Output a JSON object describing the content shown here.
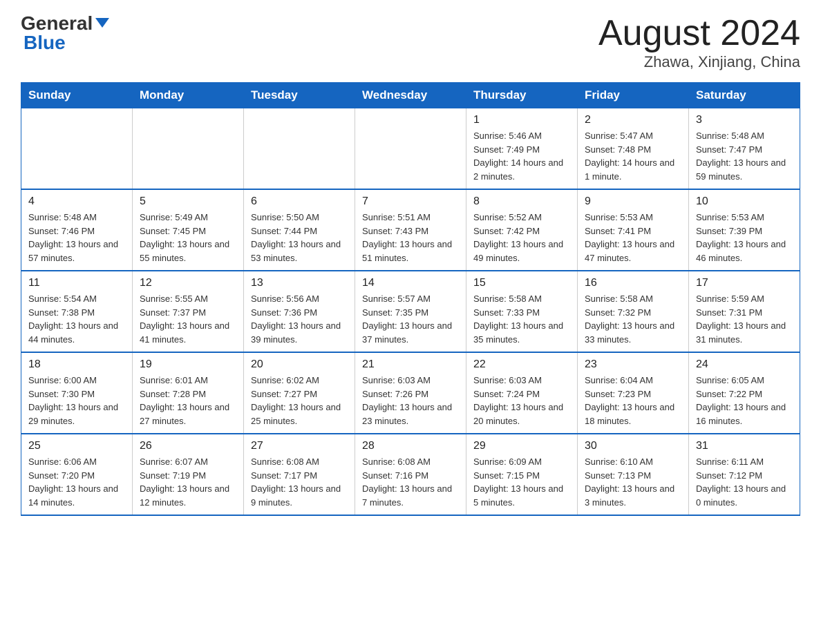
{
  "logo": {
    "general": "General",
    "blue": "Blue"
  },
  "header": {
    "month": "August 2024",
    "location": "Zhawa, Xinjiang, China"
  },
  "days_of_week": [
    "Sunday",
    "Monday",
    "Tuesday",
    "Wednesday",
    "Thursday",
    "Friday",
    "Saturday"
  ],
  "weeks": [
    [
      {
        "day": "",
        "info": ""
      },
      {
        "day": "",
        "info": ""
      },
      {
        "day": "",
        "info": ""
      },
      {
        "day": "",
        "info": ""
      },
      {
        "day": "1",
        "info": "Sunrise: 5:46 AM\nSunset: 7:49 PM\nDaylight: 14 hours and 2 minutes."
      },
      {
        "day": "2",
        "info": "Sunrise: 5:47 AM\nSunset: 7:48 PM\nDaylight: 14 hours and 1 minute."
      },
      {
        "day": "3",
        "info": "Sunrise: 5:48 AM\nSunset: 7:47 PM\nDaylight: 13 hours and 59 minutes."
      }
    ],
    [
      {
        "day": "4",
        "info": "Sunrise: 5:48 AM\nSunset: 7:46 PM\nDaylight: 13 hours and 57 minutes."
      },
      {
        "day": "5",
        "info": "Sunrise: 5:49 AM\nSunset: 7:45 PM\nDaylight: 13 hours and 55 minutes."
      },
      {
        "day": "6",
        "info": "Sunrise: 5:50 AM\nSunset: 7:44 PM\nDaylight: 13 hours and 53 minutes."
      },
      {
        "day": "7",
        "info": "Sunrise: 5:51 AM\nSunset: 7:43 PM\nDaylight: 13 hours and 51 minutes."
      },
      {
        "day": "8",
        "info": "Sunrise: 5:52 AM\nSunset: 7:42 PM\nDaylight: 13 hours and 49 minutes."
      },
      {
        "day": "9",
        "info": "Sunrise: 5:53 AM\nSunset: 7:41 PM\nDaylight: 13 hours and 47 minutes."
      },
      {
        "day": "10",
        "info": "Sunrise: 5:53 AM\nSunset: 7:39 PM\nDaylight: 13 hours and 46 minutes."
      }
    ],
    [
      {
        "day": "11",
        "info": "Sunrise: 5:54 AM\nSunset: 7:38 PM\nDaylight: 13 hours and 44 minutes."
      },
      {
        "day": "12",
        "info": "Sunrise: 5:55 AM\nSunset: 7:37 PM\nDaylight: 13 hours and 41 minutes."
      },
      {
        "day": "13",
        "info": "Sunrise: 5:56 AM\nSunset: 7:36 PM\nDaylight: 13 hours and 39 minutes."
      },
      {
        "day": "14",
        "info": "Sunrise: 5:57 AM\nSunset: 7:35 PM\nDaylight: 13 hours and 37 minutes."
      },
      {
        "day": "15",
        "info": "Sunrise: 5:58 AM\nSunset: 7:33 PM\nDaylight: 13 hours and 35 minutes."
      },
      {
        "day": "16",
        "info": "Sunrise: 5:58 AM\nSunset: 7:32 PM\nDaylight: 13 hours and 33 minutes."
      },
      {
        "day": "17",
        "info": "Sunrise: 5:59 AM\nSunset: 7:31 PM\nDaylight: 13 hours and 31 minutes."
      }
    ],
    [
      {
        "day": "18",
        "info": "Sunrise: 6:00 AM\nSunset: 7:30 PM\nDaylight: 13 hours and 29 minutes."
      },
      {
        "day": "19",
        "info": "Sunrise: 6:01 AM\nSunset: 7:28 PM\nDaylight: 13 hours and 27 minutes."
      },
      {
        "day": "20",
        "info": "Sunrise: 6:02 AM\nSunset: 7:27 PM\nDaylight: 13 hours and 25 minutes."
      },
      {
        "day": "21",
        "info": "Sunrise: 6:03 AM\nSunset: 7:26 PM\nDaylight: 13 hours and 23 minutes."
      },
      {
        "day": "22",
        "info": "Sunrise: 6:03 AM\nSunset: 7:24 PM\nDaylight: 13 hours and 20 minutes."
      },
      {
        "day": "23",
        "info": "Sunrise: 6:04 AM\nSunset: 7:23 PM\nDaylight: 13 hours and 18 minutes."
      },
      {
        "day": "24",
        "info": "Sunrise: 6:05 AM\nSunset: 7:22 PM\nDaylight: 13 hours and 16 minutes."
      }
    ],
    [
      {
        "day": "25",
        "info": "Sunrise: 6:06 AM\nSunset: 7:20 PM\nDaylight: 13 hours and 14 minutes."
      },
      {
        "day": "26",
        "info": "Sunrise: 6:07 AM\nSunset: 7:19 PM\nDaylight: 13 hours and 12 minutes."
      },
      {
        "day": "27",
        "info": "Sunrise: 6:08 AM\nSunset: 7:17 PM\nDaylight: 13 hours and 9 minutes."
      },
      {
        "day": "28",
        "info": "Sunrise: 6:08 AM\nSunset: 7:16 PM\nDaylight: 13 hours and 7 minutes."
      },
      {
        "day": "29",
        "info": "Sunrise: 6:09 AM\nSunset: 7:15 PM\nDaylight: 13 hours and 5 minutes."
      },
      {
        "day": "30",
        "info": "Sunrise: 6:10 AM\nSunset: 7:13 PM\nDaylight: 13 hours and 3 minutes."
      },
      {
        "day": "31",
        "info": "Sunrise: 6:11 AM\nSunset: 7:12 PM\nDaylight: 13 hours and 0 minutes."
      }
    ]
  ]
}
